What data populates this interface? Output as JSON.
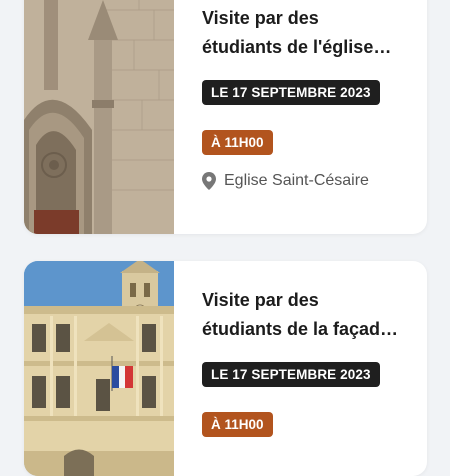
{
  "events": [
    {
      "title_line1": "Visite par des",
      "title_line2": "étudiants de l'église…",
      "date_badge": "LE 17 SEPTEMBRE 2023",
      "time_badge": "À 11H00",
      "location": "Eglise Saint-Césaire",
      "location_icon": "map-pin-icon",
      "image": "church-gothic-portal-photo"
    },
    {
      "title_line1": "Visite par des",
      "title_line2": "étudiants de la façad…",
      "date_badge": "LE 17 SEPTEMBRE 2023",
      "time_badge": "À 11H00",
      "image": "town-hall-facade-photo"
    }
  ],
  "colors": {
    "date_badge_bg": "#1f1f1f",
    "time_badge_bg": "#b2541e",
    "page_bg": "#f1f3f6"
  }
}
